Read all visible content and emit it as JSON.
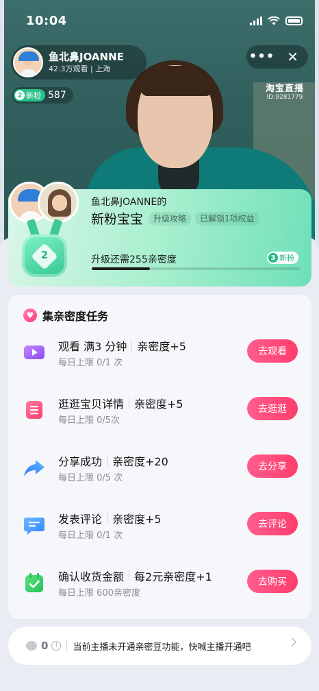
{
  "status_bar": {
    "time": "10:04"
  },
  "anchor": {
    "name": "鱼北鼻JOANNE",
    "viewers": "42.3万观看",
    "location": "上海",
    "new_fan_level": "2",
    "new_fan_label": "新粉",
    "fan_count": "587"
  },
  "top_right": {
    "more": "•••",
    "close": "✕"
  },
  "brand": {
    "name": "淘宝直播",
    "id": "ID:9281779"
  },
  "fan_card": {
    "title": "鱼北鼻JOANNE的",
    "level_name": "新粉宝宝",
    "upgrade_guide": "升级攻略",
    "unlocked": "已解锁1项权益",
    "current_level": "2",
    "need_text": "升级还需255亲密度",
    "next_level": "3",
    "next_label": "新粉",
    "progress_fraction": 0.28
  },
  "tasks": {
    "title": "集亲密度任务",
    "items": [
      {
        "icon": "play-icon",
        "name": "观看 满3 分钟",
        "reward": "亲密度+5",
        "limit": "每日上限 0/1 次",
        "action": "去观看"
      },
      {
        "icon": "list-icon",
        "name": "逛逛宝贝详情",
        "reward": "亲密度+5",
        "limit": "每日上限 0/5次",
        "action": "去逛逛"
      },
      {
        "icon": "share-icon",
        "name": "分享成功",
        "reward": "亲密度+20",
        "limit": "每日上限 0/5 次",
        "action": "去分享"
      },
      {
        "icon": "comment-icon",
        "name": "发表评论",
        "reward": "亲密度+5",
        "limit": "每日上限 0/1 次",
        "action": "去评论"
      },
      {
        "icon": "calendar-check-icon",
        "name": "确认收货金额",
        "reward": "每2元亲密度+1",
        "limit": "每日上限 600亲密度",
        "action": "去购买"
      }
    ]
  },
  "bottom_bar": {
    "bean_count": "0",
    "info": "!",
    "notice": "当前主播未开通亲密豆功能，快喊主播开通吧"
  },
  "colors": {
    "accent_pink": "#ff3d6c",
    "fan_green": "#24b883",
    "hero_teal": "#2f5e5c"
  }
}
